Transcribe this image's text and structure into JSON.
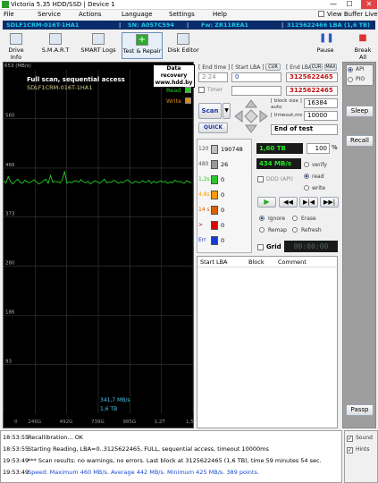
{
  "window": {
    "title": "Victoria 5.35 HDD/SSD | Device 1",
    "minimize": "—",
    "maximize": "☐",
    "close": "✕"
  },
  "menu": {
    "file": "File",
    "service": "Service",
    "actions": "Actions",
    "language": "Language",
    "settings": "Settings",
    "help": "Help",
    "view_buffer": "View Buffer Live"
  },
  "infobar": {
    "model": "SDLF1CRM-016T-1HA1",
    "serial": "SN: A057C594",
    "firmware": "Fw: ZR11REA1",
    "capacity": "3125622466 LBA (1,6 TB)"
  },
  "toolbar": {
    "drive_info": "Drive Info",
    "smart": "S.M.A.R.T",
    "smart_logs": "SMART Logs",
    "test_repair": "Test & Repair",
    "disk_editor": "Disk Editor",
    "pause": "Pause",
    "break_all": "Break All"
  },
  "graph": {
    "scale_top": "653 (MB/s)",
    "title": "Full scan, sequential access",
    "model": "SDLF1CRM-016T-1HA1",
    "banner_line1": "Data recovery",
    "banner_line2": "www.hdd.by",
    "legend_read": "Read",
    "legend_write": "Write",
    "y_labels": [
      "560",
      "466",
      "373",
      "280",
      "186",
      "93"
    ],
    "x_labels": [
      "0",
      "246G",
      "492G",
      "739G",
      "985G",
      "1,2T",
      "1,5T"
    ],
    "overlay_speed": "341,7 MB/s",
    "overlay_pos": "1,6 TB",
    "read_color": "#22cc22"
  },
  "chart_data": {
    "type": "line",
    "title": "Full scan, sequential access",
    "ylabel": "MB/s",
    "ylim": [
      0,
      653
    ],
    "x_tick_labels": [
      "0",
      "246G",
      "492G",
      "739G",
      "985G",
      "1,2T",
      "1,5T"
    ],
    "series": [
      {
        "name": "Read",
        "x": [
          0,
          20,
          40,
          60,
          80,
          100,
          120,
          140,
          160,
          180,
          200,
          220,
          240,
          260,
          280,
          300,
          320,
          340,
          360,
          380,
          400,
          420,
          440,
          460,
          480,
          500,
          520,
          540,
          560,
          580,
          600,
          620,
          640,
          660,
          680,
          700,
          720,
          740,
          760,
          780,
          800,
          820,
          840,
          860,
          880,
          900,
          920,
          940,
          960,
          980,
          1000,
          1020,
          1040,
          1060,
          1080,
          1100,
          1120,
          1140,
          1160,
          1180,
          1200,
          1220,
          1240,
          1260,
          1280,
          1300,
          1320,
          1340,
          1360,
          1380,
          1400,
          1420,
          1440,
          1460,
          1480,
          1500,
          1520,
          1540,
          1560,
          1580,
          1600
        ],
        "y": [
          442,
          438,
          450,
          440,
          436,
          441,
          445,
          439,
          437,
          443,
          440,
          438,
          441,
          444,
          440,
          436,
          438,
          442,
          445,
          437,
          452,
          439,
          441,
          440,
          438,
          443,
          460,
          437,
          440,
          438,
          441,
          442,
          439,
          444,
          440,
          438,
          441,
          436,
          439,
          442,
          440,
          437,
          441,
          445,
          438,
          440,
          439,
          443,
          441,
          437,
          440,
          438,
          442,
          444,
          439,
          437,
          441,
          440,
          438,
          442,
          440,
          439,
          443,
          437,
          441,
          438,
          440,
          442,
          439,
          441,
          437,
          440,
          438,
          443,
          440,
          441,
          439,
          437,
          442,
          440,
          438
        ]
      }
    ]
  },
  "controls": {
    "end_time_label": "[ End time ]",
    "end_time_value": "2:24",
    "timer_label": "Timer",
    "start_lba_label": "[ Start LBA ]",
    "start_lba_value": "0",
    "cur_label": "CUR",
    "end_lba_label": "[ End LBA ]",
    "end_lba_cur": "CUR",
    "end_lba_max": "MAX",
    "end_lba_value": "3125622465",
    "cur_lba_value": "3125622465",
    "block_size_label": "[ block size ]",
    "block_auto": "auto",
    "block_size_value": "16384",
    "timeout_label": "[ timeout,ms ]",
    "timeout_value": "10000",
    "end_of_test": "End of test",
    "scan_button": "Scan",
    "quick_button": "QUICK",
    "size_readout": "1,60 TB",
    "percent_value": "100",
    "percent_unit": "%",
    "speed_readout": "434 MB/s",
    "ddd_api": "DDD (API)",
    "verify": "verify",
    "read": "read",
    "write": "write",
    "ignore": "Ignore",
    "erase": "Erase",
    "remap": "Remap",
    "refresh": "Refresh",
    "grid": "Grid",
    "timer_display": "00:00:00"
  },
  "histogram": [
    {
      "label": "120",
      "count": "190748",
      "color": "#bdbdbd"
    },
    {
      "label": "480",
      "count": "26",
      "color": "#9a9a9a"
    },
    {
      "label": "1,2s",
      "count": "0",
      "color": "#2ec62e"
    },
    {
      "label": "4,8s",
      "count": "0",
      "color": "#ff9a00"
    },
    {
      "label": "14 s",
      "count": "0",
      "color": "#e06000"
    },
    {
      "label": ">",
      "count": "0",
      "color": "#e00000"
    },
    {
      "label": "Err",
      "count": "0",
      "color": "#1a3ad0"
    }
  ],
  "table": {
    "col_start_lba": "Start LBA",
    "col_block": "Block",
    "col_comment": "Comment"
  },
  "side": {
    "api": "API",
    "pio": "PIO",
    "sleep": "Sleep",
    "recall": "Recall",
    "passp": "Passp",
    "sound": "Sound",
    "hints": "Hints"
  },
  "log": [
    {
      "time": "18:53:55",
      "text": "Recallibration... OK",
      "color": "#000"
    },
    {
      "time": "18:53:55",
      "text": "Starting Reading, LBA=0..3125622465, FULL, sequential access, timeout 10000ms",
      "color": "#000"
    },
    {
      "time": "19:53:49",
      "text": "*** Scan results: no warnings, no errors. Last block at 3125622465 (1,6 TB), time 59 minutes 54 sec.",
      "color": "#000"
    },
    {
      "time": "19:53:49",
      "text": "Speed: Maximum 460 MB/s. Average 442 MB/s. Minimum 425 MB/s. 389 points.",
      "color": "#1a4ad0"
    }
  ]
}
